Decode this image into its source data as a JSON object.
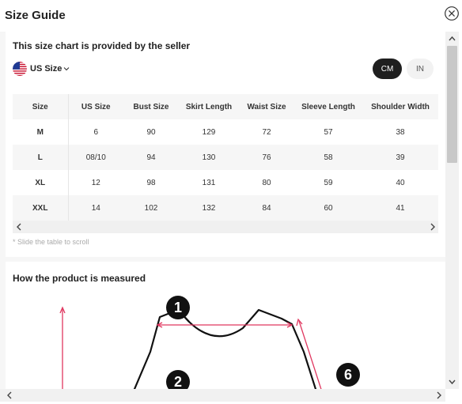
{
  "header": {
    "title": "Size Guide"
  },
  "seller_note": "This size chart is provided by the seller",
  "size_system": {
    "label": "US Size"
  },
  "units": {
    "cm": "CM",
    "in": "IN",
    "selected": "CM"
  },
  "table": {
    "columns": [
      "Size",
      "US Size",
      "Bust Size",
      "Skirt Length",
      "Waist Size",
      "Sleeve Length",
      "Shoulder Width"
    ],
    "rows": [
      [
        "M",
        "6",
        "90",
        "129",
        "72",
        "57",
        "38"
      ],
      [
        "L",
        "08/10",
        "94",
        "130",
        "76",
        "58",
        "39"
      ],
      [
        "XL",
        "12",
        "98",
        "131",
        "80",
        "59",
        "40"
      ],
      [
        "XXL",
        "14",
        "102",
        "132",
        "84",
        "60",
        "41"
      ]
    ]
  },
  "scroll_hint": "* Slide the table to scroll",
  "measured": {
    "title": "How the product is measured",
    "markers": [
      "1",
      "2",
      "6"
    ]
  },
  "colors": {
    "accent": "#e0375f",
    "dark": "#1f1f1f"
  },
  "icons": {
    "close": "close-icon",
    "flag": "us-flag-icon",
    "chevron": "chevron-down-icon"
  }
}
